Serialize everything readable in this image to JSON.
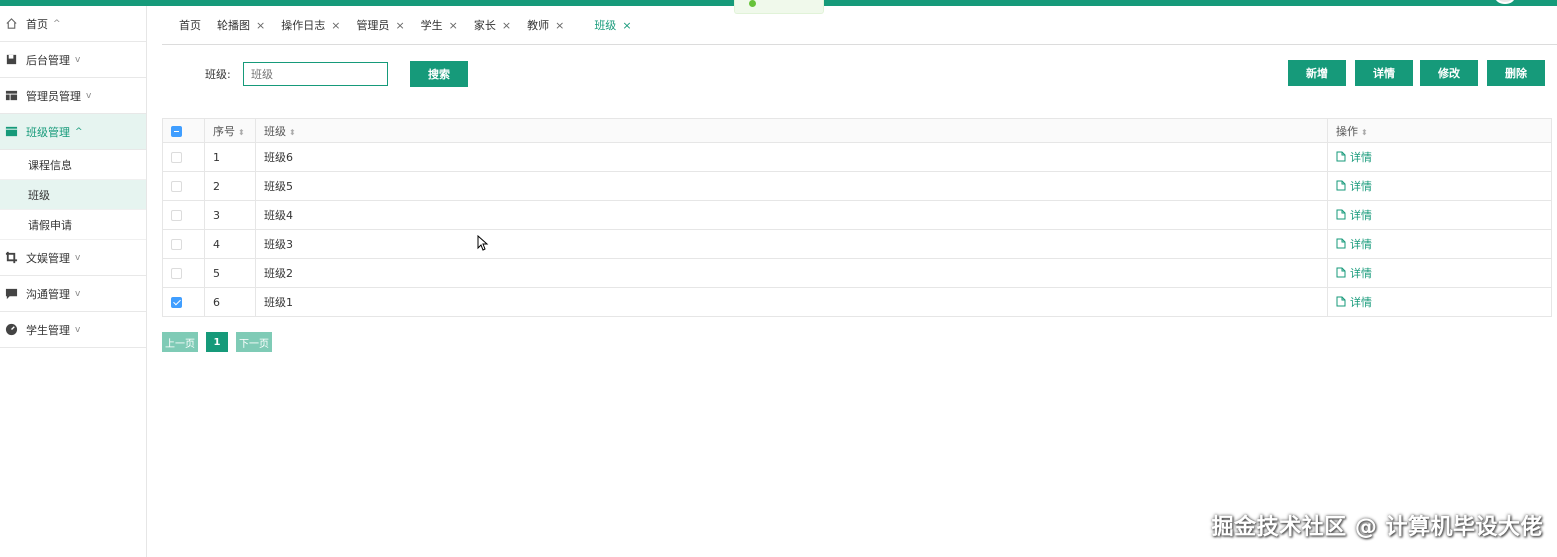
{
  "colors": {
    "primary": "#169a7a",
    "checkbox": "#409eff",
    "pager_light": "#7fcbb6"
  },
  "sidebar": {
    "items": [
      {
        "label": "首页",
        "icon": "home-icon",
        "chevron": "^"
      },
      {
        "label": "后台管理",
        "icon": "save-icon",
        "chevron": "v"
      },
      {
        "label": "管理员管理",
        "icon": "layout-icon",
        "chevron": "v"
      },
      {
        "label": "班级管理",
        "icon": "folder-icon",
        "chevron": "^"
      },
      {
        "label": "文娱管理",
        "icon": "crop-icon",
        "chevron": "v"
      },
      {
        "label": "沟通管理",
        "icon": "chat-icon",
        "chevron": "v"
      },
      {
        "label": "学生管理",
        "icon": "dashboard-icon",
        "chevron": "v"
      }
    ],
    "sub_items": [
      "课程信息",
      "班级",
      "请假申请"
    ]
  },
  "tabs": [
    {
      "label": "首页"
    },
    {
      "label": "轮播图",
      "close": "×"
    },
    {
      "label": "操作日志",
      "close": "×"
    },
    {
      "label": "管理员",
      "close": "×"
    },
    {
      "label": "学生",
      "close": "×"
    },
    {
      "label": "家长",
      "close": "×"
    },
    {
      "label": "教师",
      "close": "×"
    },
    {
      "label": "班级",
      "close": "×"
    }
  ],
  "search": {
    "label": "班级:",
    "placeholder": "班级",
    "button": "搜索"
  },
  "toolbar": {
    "add": "新增",
    "detail": "详情",
    "edit": "修改",
    "delete": "删除"
  },
  "table": {
    "headers": [
      "序号",
      "班级",
      "操作"
    ],
    "rows": [
      {
        "index": "1",
        "name": "班级6",
        "action": "详情",
        "checked": false
      },
      {
        "index": "2",
        "name": "班级5",
        "action": "详情",
        "checked": false
      },
      {
        "index": "3",
        "name": "班级4",
        "action": "详情",
        "checked": false
      },
      {
        "index": "4",
        "name": "班级3",
        "action": "详情",
        "checked": false
      },
      {
        "index": "5",
        "name": "班级2",
        "action": "详情",
        "checked": false
      },
      {
        "index": "6",
        "name": "班级1",
        "action": "详情",
        "checked": true
      }
    ]
  },
  "pager": {
    "prev": "上一页",
    "page": "1",
    "next": "下一页"
  },
  "watermark": "掘金技术社区 @ 计算机毕设大佬"
}
